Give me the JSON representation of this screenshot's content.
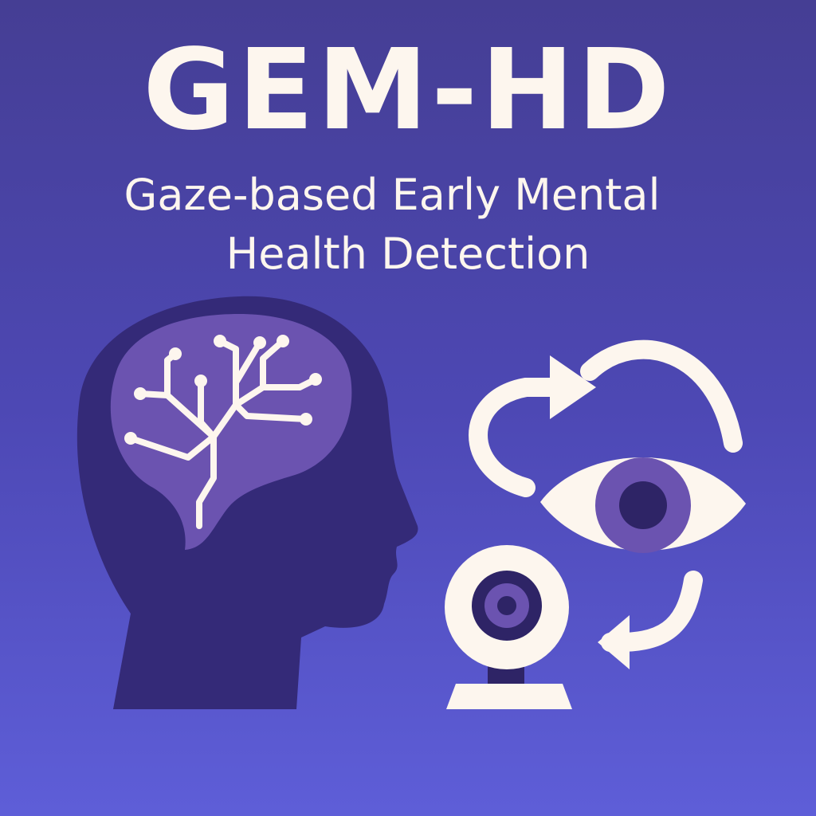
{
  "header": {
    "title": "GEM-HD",
    "subtitle_line1": "Gaze-based Early Mental",
    "subtitle_line2": "Health Detection"
  },
  "illustration": {
    "icons": [
      "head-silhouette-icon",
      "brain-circuit-icon",
      "cycle-arrows-icon",
      "eye-icon",
      "webcam-icon"
    ],
    "colors": {
      "background_top": "#453e94",
      "background_bottom": "#5e5ed8",
      "head": "#342a78",
      "brain": "#6b53b0",
      "cream": "#fdf6ee",
      "iris": "#6b53b0",
      "pupil": "#2e2466"
    }
  }
}
